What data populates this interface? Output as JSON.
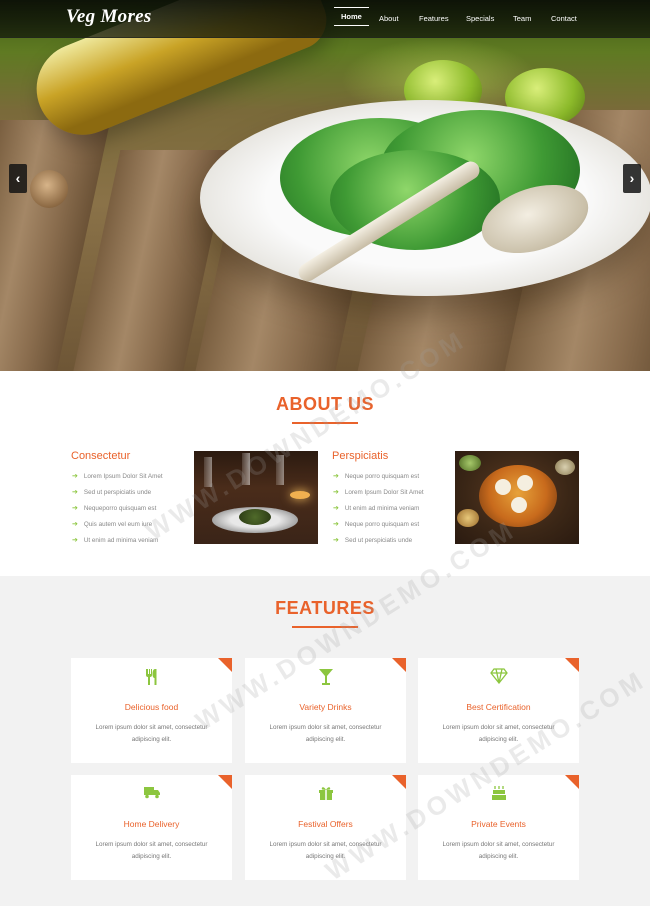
{
  "header": {
    "logo": "Veg Mores",
    "nav": [
      {
        "label": "Home",
        "active": true
      },
      {
        "label": "About",
        "active": false
      },
      {
        "label": "Features",
        "active": false
      },
      {
        "label": "Specials",
        "active": false
      },
      {
        "label": "Team",
        "active": false
      },
      {
        "label": "Contact",
        "active": false
      }
    ]
  },
  "slider": {
    "prev_icon": "‹",
    "next_icon": "›"
  },
  "about": {
    "title": "ABOUT US",
    "left": {
      "heading": "Consectetur",
      "items": [
        "Lorem Ipsum Dolor Sit Amet",
        "Sed ut perspiciatis unde",
        "Nequeporro quisquam est",
        "Quis autem vel eum iure",
        "Ut enim ad minima veniam"
      ]
    },
    "right": {
      "heading": "Perspiciatis",
      "items": [
        "Neque porro quisquam est",
        "Lorem Ipsum Dolor Sit Amet",
        "Ut enim ad minima veniam",
        "Neque porro quisquam est",
        "Sed ut perspiciatis unde"
      ]
    }
  },
  "features": {
    "title": "FEATURES",
    "cards": [
      {
        "icon": "cutlery-icon",
        "title": "Delicious food",
        "text": "Lorem ipsum dolor sit amet, consectetur adipiscing elit."
      },
      {
        "icon": "cocktail-icon",
        "title": "Variety Drinks",
        "text": "Lorem ipsum dolor sit amet, consectetur adipiscing elit."
      },
      {
        "icon": "diamond-icon",
        "title": "Best Certification",
        "text": "Lorem ipsum dolor sit amet, consectetur adipiscing elit."
      },
      {
        "icon": "truck-icon",
        "title": "Home Delivery",
        "text": "Lorem ipsum dolor sit amet, consectetur adipiscing elit."
      },
      {
        "icon": "gift-icon",
        "title": "Festival Offers",
        "text": "Lorem ipsum dolor sit amet, consectetur adipiscing elit."
      },
      {
        "icon": "cake-icon",
        "title": "Private Events",
        "text": "Lorem ipsum dolor sit amet, consectetur adipiscing elit."
      }
    ]
  },
  "colors": {
    "accent": "#e9622b",
    "green": "#8cc63f"
  },
  "watermark": "WWW.DOWNDEMO.COM"
}
